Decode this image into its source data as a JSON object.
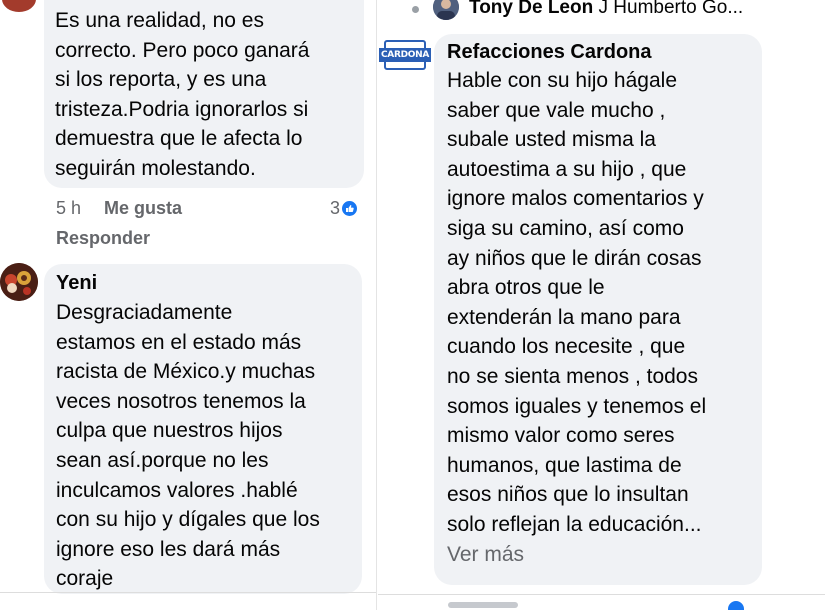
{
  "left_column": {
    "comment1": {
      "text": "Es una realidad, no es\ncorrecto. Pero poco ganará\nsi los reporta, y es una\ntristeza.Podria ignorarlos si\ndemuestra que le afecta lo\nseguirán molestando.",
      "time": "5 h",
      "like_label": "Me gusta",
      "reply_label": "Responder",
      "reaction_count": "3",
      "reaction_icon": "like-reaction-icon",
      "reaction_color": "#1877f2"
    },
    "comment2": {
      "author": "Yeni",
      "text": "Desgraciadamente\nestamos en el estado más\nracista de México.y muchas\nveces nosotros tenemos la\nculpa que nuestros hijos\nsean así.porque no les\ninculcamos valores .hablé\ncon su hijo y dígales que los\nignore eso les dará más\ncoraje"
    }
  },
  "right_column": {
    "reply_preview": {
      "author": "Tony De Leon",
      "text": "J Humberto Go..."
    },
    "comment3": {
      "author": "Refacciones Cardona",
      "logo_text": "CARDONA",
      "text": "Hable con su hijo hágale\nsaber que vale mucho ,\nsubale usted misma la\nautoestima a su hijo , que\nignore malos comentarios y\nsiga su camino, así como\nay niños que le dirán cosas\nabra otros que le\nextenderán la mano para\ncuando los necesite , que\nno se sienta menos , todos\nsomos iguales y tenemos el\nmismo valor como seres\nhumanos, que lastima de\nesos niños que lo insultan\nsolo reflejan la educación...",
      "see_more": "Ver más"
    }
  }
}
